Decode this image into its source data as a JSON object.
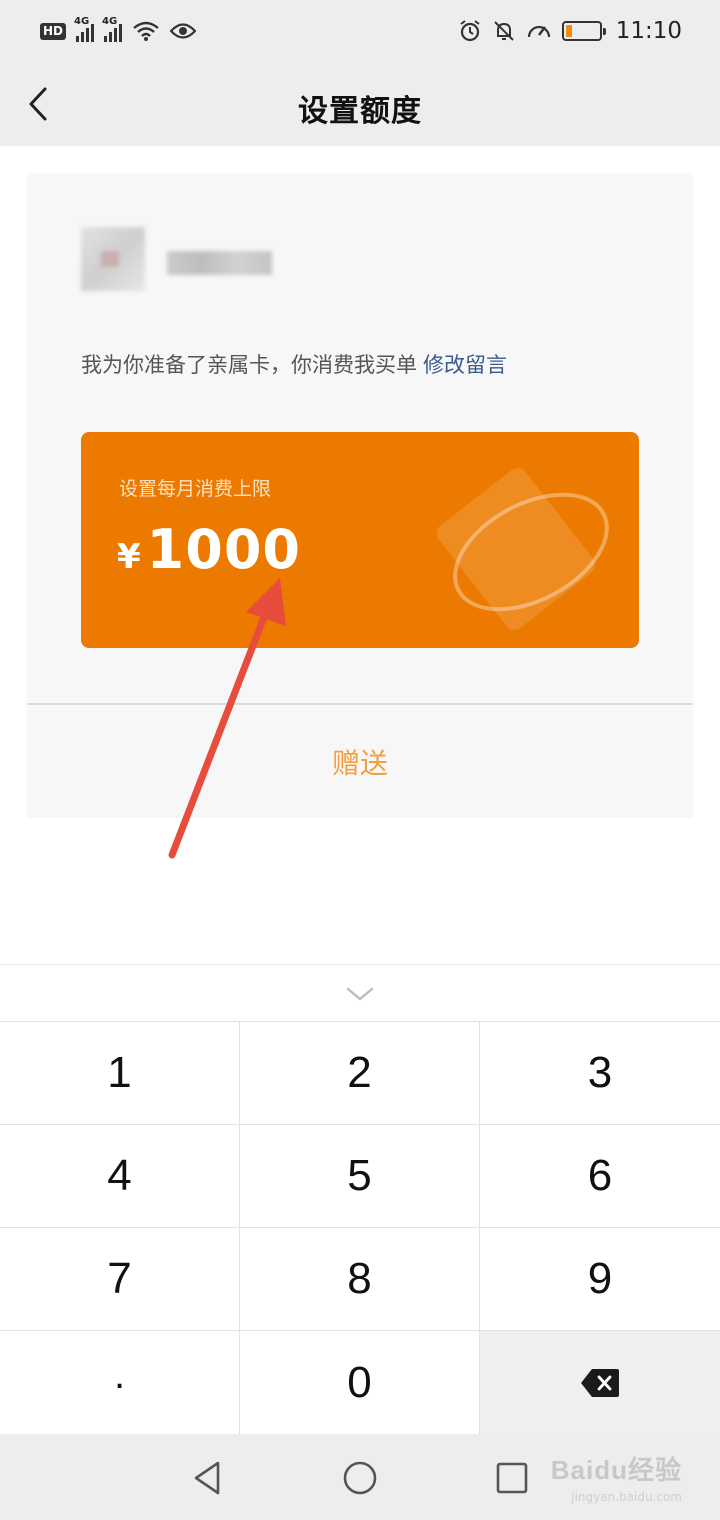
{
  "status_bar": {
    "hd_label": "HD",
    "network_1": "4G",
    "network_2": "4G",
    "time": "11:10",
    "battery_level": 0.2,
    "icons": [
      "hd-icon",
      "signal-icon",
      "signal-icon",
      "wifi-icon",
      "eye-icon",
      "alarm-icon",
      "mute-icon",
      "speed-icon",
      "battery-icon"
    ]
  },
  "nav": {
    "title": "设置额度",
    "back_icon": "chevron-left-icon"
  },
  "card_panel": {
    "message": "我为你准备了亲属卡，你消费我买单",
    "edit_link": "修改留言",
    "card": {
      "label": "设置每月消费上限",
      "currency": "¥",
      "amount": "1000",
      "color": "#ec7a00"
    },
    "send_label": "赠送",
    "send_color": "#f0a040"
  },
  "keyboard": {
    "hide_icon": "chevron-down-icon",
    "keys": [
      "1",
      "2",
      "3",
      "4",
      "5",
      "6",
      "7",
      "8",
      "9",
      ".",
      "0"
    ],
    "backspace_icon": "backspace-icon"
  },
  "system_nav": {
    "icons": [
      "back-triangle-icon",
      "home-circle-icon",
      "recents-square-icon"
    ]
  },
  "watermark": {
    "text": "Baidu经验",
    "sub": "jingyan.baidu.com"
  }
}
